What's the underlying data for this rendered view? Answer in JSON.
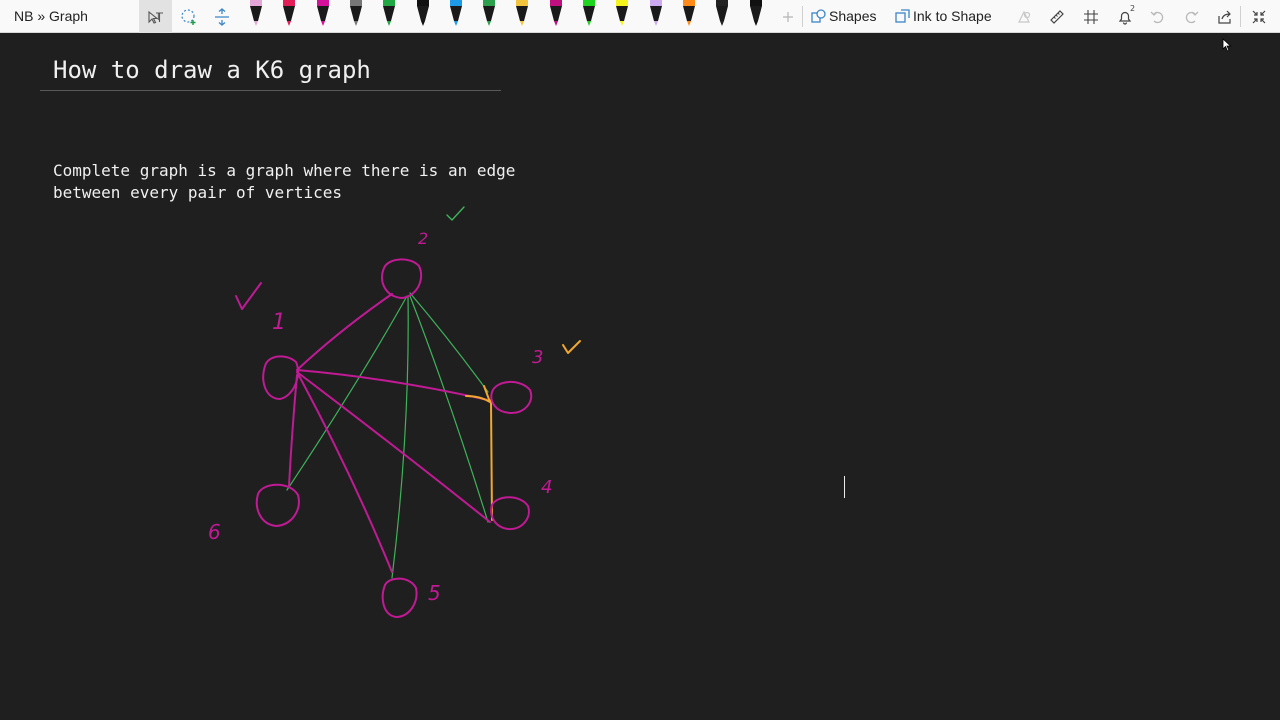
{
  "toolbar": {
    "breadcrumb": "NB » Graph",
    "shapes_label": "Shapes",
    "ink_to_shape_label": "Ink to Shape",
    "notification_count": "2",
    "pen_colors": [
      "#e3a6d6",
      "#e11e57",
      "#d4119a",
      "#777777",
      "#1fa844",
      "#111111",
      "#1e9be8",
      "#2ca04d",
      "#f2c43c",
      "#c0107f",
      "#1ed41e",
      "#f4f41c",
      "#cdaaf0",
      "#ff8a1a",
      "#222222",
      "#111111"
    ]
  },
  "page": {
    "title": "How to draw a K6 graph",
    "description_line1": "Complete graph is a graph where there is an edge",
    "description_line2": "between every pair of vertices"
  },
  "graph": {
    "vertex_labels": [
      "1",
      "2",
      "3",
      "4",
      "5",
      "6"
    ],
    "check_mark": "✓",
    "colors": {
      "magenta": "#c01a95",
      "green": "#3fb25a",
      "orange": "#f0a830"
    }
  }
}
